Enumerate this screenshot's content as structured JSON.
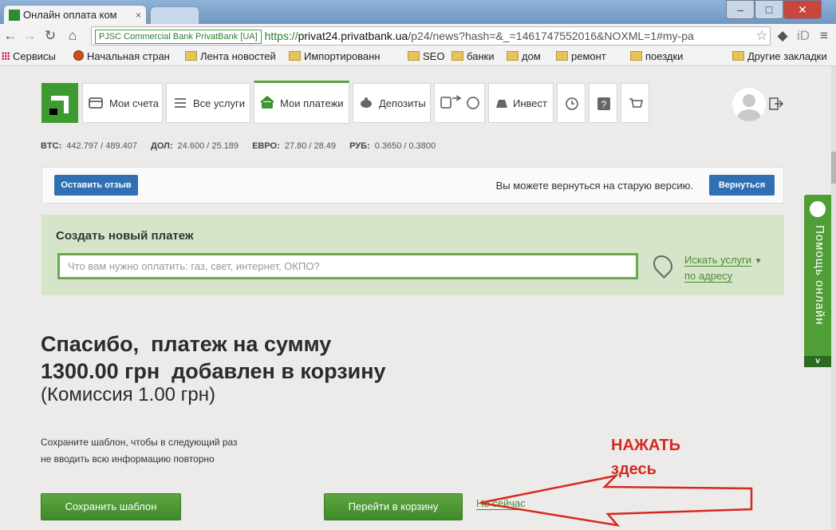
{
  "browser": {
    "tab_title": "Онлайн оплата ком",
    "tab_close": "×",
    "win_min": "–",
    "win_max": "□",
    "win_close": "✕",
    "ssl_label": "PJSC Commercial Bank PrivatBank [UA]",
    "url_scheme": "https://",
    "url_host": "privat24.privatbank.ua",
    "url_path": "/p24/news?hash=&_=1461747552016&NOXML=1#my-pa",
    "bookmarks": [
      {
        "label": "Сервисы",
        "icon": "apps-icon"
      },
      {
        "label": "Начальная стран",
        "icon": "page-icon"
      },
      {
        "label": "Лента новостей",
        "icon": "folder-icon"
      },
      {
        "label": "Импортированн",
        "icon": "folder-icon"
      },
      {
        "label": "SEO",
        "icon": "folder-icon"
      },
      {
        "label": "банки",
        "icon": "folder-icon"
      },
      {
        "label": "дом",
        "icon": "folder-icon"
      },
      {
        "label": "ремонт",
        "icon": "folder-icon"
      },
      {
        "label": "поездки",
        "icon": "folder-icon"
      }
    ],
    "other_bookmarks": "Другие закладки"
  },
  "nav": {
    "accounts": "Мои счета",
    "services": "Все услуги",
    "payments": "Мои платежи",
    "deposits": "Депозиты",
    "invest": "Инвест"
  },
  "rates": [
    {
      "name": "BTC:",
      "value": "442.797 / 489.407"
    },
    {
      "name": "ДОЛ:",
      "value": "24.600 / 25.189"
    },
    {
      "name": "ЕВРО:",
      "value": "27.80 / 28.49"
    },
    {
      "name": "РУБ:",
      "value": "0.3650 / 0.3800"
    }
  ],
  "feedback": {
    "leave_feedback": "Оставить отзыв",
    "old_version_text": "Вы можете вернуться на старую версию.",
    "return_button": "Вернуться"
  },
  "new_payment": {
    "title": "Создать новый платеж",
    "placeholder": "Что вам нужно оплатить: газ, свет, интернет, ОКПО?",
    "find_line1": "Искать услуги",
    "find_line2": "по адресу"
  },
  "result": {
    "line1": "Спасибо,  платеж на сумму",
    "line2": "1300.00 грн  добавлен в корзину",
    "commission": "(Комиссия 1.00 грн)",
    "hint_line1": "Сохраните шаблон, чтобы в следующий раз",
    "hint_line2": "не вводить всю информацию повторно",
    "save_template": "Сохранить шаблон",
    "go_to_cart": "Перейти в корзину",
    "not_now": "Не сейчас"
  },
  "annotation": {
    "line1": "НАЖАТЬ",
    "line2": "здесь",
    "color": "#d42a20"
  },
  "help_widget": {
    "label": "Помощь онлайн",
    "toggle": "v"
  }
}
